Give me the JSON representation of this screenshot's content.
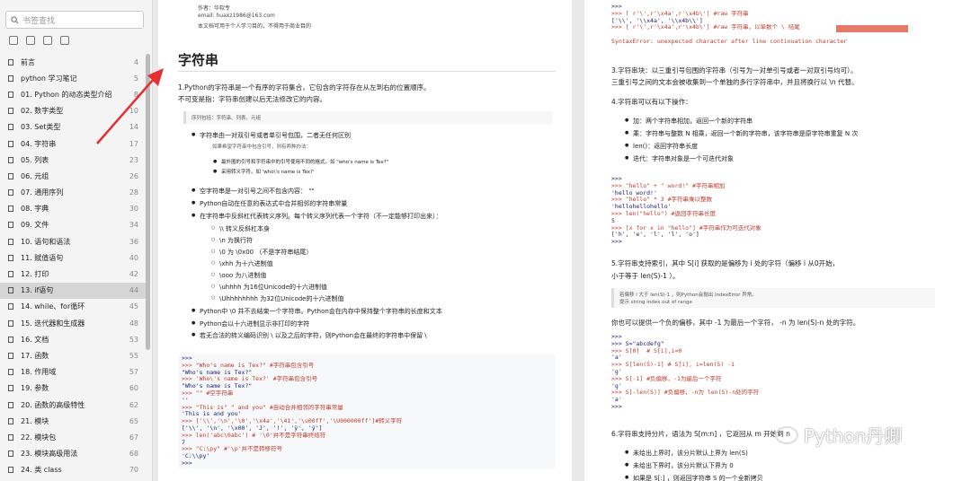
{
  "sidebar": {
    "search_placeholder": "书签查找",
    "items": [
      {
        "label": "前言",
        "page": "4"
      },
      {
        "label": "python 学习笔记",
        "page": "5"
      },
      {
        "label": "01. Python 的动态类型介绍",
        "page": "8"
      },
      {
        "label": "02. 数字类型",
        "page": "10"
      },
      {
        "label": "03. Set类型",
        "page": "14"
      },
      {
        "label": "04. 字符串",
        "page": "17"
      },
      {
        "label": "05. 列表",
        "page": "23"
      },
      {
        "label": "06. 元组",
        "page": "26"
      },
      {
        "label": "07. 通用序列",
        "page": "28"
      },
      {
        "label": "08. 字典",
        "page": "30"
      },
      {
        "label": "09. 文件",
        "page": "34"
      },
      {
        "label": "10. 语句和语法",
        "page": "36"
      },
      {
        "label": "11. 赋值语句",
        "page": "40"
      },
      {
        "label": "12. 打印",
        "page": "42"
      },
      {
        "label": "13. if语句",
        "page": "44"
      },
      {
        "label": "14. while、for循环",
        "page": "45"
      },
      {
        "label": "15. 迭代器和生成器",
        "page": "48"
      },
      {
        "label": "16. 文档",
        "page": "53"
      },
      {
        "label": "17. 函数",
        "page": "55"
      },
      {
        "label": "18. 作用域",
        "page": "57"
      },
      {
        "label": "19. 参数",
        "page": "60"
      },
      {
        "label": "20. 函数的高级特性",
        "page": "62"
      },
      {
        "label": "21. 模块",
        "page": "65"
      },
      {
        "label": "22. 模块包",
        "page": "67"
      },
      {
        "label": "23. 模块高级用法",
        "page": "68"
      },
      {
        "label": "24. 类 class",
        "page": "70"
      }
    ]
  },
  "left": {
    "meta1": "作者：华软专",
    "meta2": "email: huaxz1986@163.com",
    "meta3": "本文档可用于个人学习目的，不得用于商业目的",
    "title": "字符串",
    "intro1": "1.Python的字符串是一个有序的字符集合，它包含的字符存在从左到右的位置顺序。",
    "intro2": "不可变是指：字符串创建以后无法修改它的内容。",
    "quote": "序列包括：字符串、列表、元组",
    "b1": "字符串由一对双引号或者单引号包围，二者无任何区别",
    "s1": "如果希望字符串中包含引号，则有两种办法：",
    "s2": "最外围的引号和字符串中的引号使用不同的格式。如 \"who's name is Tex?\"",
    "s3": "采用转义字符。如 'who\\'s name is Tex?'",
    "b2": "空字符串是一对引号之间不包含内容： \"\"",
    "b3": "Python自动在任意的表达式中合并相邻的字符串常量",
    "b4": "在字符串中反斜杠代表转义序列。每个转义序列代表一个字符（不一定能够打印出来）：",
    "e1": "\\\\ 转义反斜杠本身",
    "e2": "\\n 为换行符",
    "e3": "\\0 为 \\0x00 （不是字符串结尾）",
    "e4": "\\xhh 为十六进制值",
    "e5": "\\ooo 为八进制值",
    "e6": "\\uhhhh 为16位Unicode的十六进制值",
    "e7": "\\Uhhhhhhhh 为32位Unicode的十六进制值",
    "b5": "Python中 \\0 并不去结束一个字符串。Python会在内存中保持整个字符串的长度和文本",
    "b6": "Python会以十六进制显示非打印的字符",
    "b7": "若无合法的转义编码识别 \\ 以及之后的字符，则Python会在最终的字符串中保留 \\",
    "code": [
      ">>>",
      ">>> \"Who's name is Tex?\" #字符串包含引号",
      "\"Who's name is Tex?\"",
      ">>> 'Who\\'s name is Tex?' #字符串包含引号",
      "\"Who's name is Tex?\"",
      ">>> \"\" #空字符串",
      "''",
      ">>> \"This is\" \" and you\" #自动合并相邻的字符串常量",
      "'This is and you'",
      ">>> ['\\\\','\\n','\\0','\\x4a','\\41','\\u00ff','\\U000000ff']#转义字符",
      "['\\\\', '\\n', '\\x00', 'J', '!', 'ÿ', 'ÿ']",
      ">>> len('abc\\0abc') # '\\0'并不是字符串终结符",
      "7",
      ">>> \"C:\\py\" #'\\p'并不是转移符号",
      "'C:\\\\py'",
      ">>>"
    ]
  },
  "right": {
    "code_top": [
      ">>>",
      ">>> [ r'\\',r'\\x4a',r'\\x4b\\'] #raw 字符串",
      "['\\\\', '\\\\x4a', '\\\\x4b\\\\']",
      ">>> [ r'\\',r'\\x4a',r'\\x4b\\'] #raw 字符串，以单数个 \\ 结尾",
      "",
      "SyntaxError: unexpected character after line continuation character"
    ],
    "p3a": "3.字符串块：以三重引号包围的字符串（引号为一对单引号或者一对双引号均可）。",
    "p3b": "三重引号之间的文本会被收集到一个单独的多行字符串中，并且将换行以 \\n 代替。",
    "p4": "4.字符串可以有以下操作：",
    "r1": "加：两个字符串相加，返回一个新的字符串",
    "r2": "乘：字符串与整数 N 相乘，返回一个新的字符串，该字符串是原字符串重复 N 次",
    "r3": "len()：返回字符串长度",
    "r4": "迭代：字符串对象是一个可迭代对象",
    "code_mid": [
      ">>>",
      ">>> \"hello\" + \" word!\" #字符串相加",
      "'hello word!'",
      ">>> \"hello\" * 3 #字符串乘以整数",
      "'hellohellohello'",
      ">>> len(\"hello\") #返回字符串长度",
      "5",
      ">>> [x for x in \"hello\"] #字符串作为可迭代对象",
      "['h', 'e', 'l', 'l', 'o']",
      ">>>"
    ],
    "p5a": "5.字符串支持索引，其中 S[i] 获取的是偏移为 i 处的字符（偏移 i 从0开始，",
    "p5b": "小于等于 len(S)-1 ）。",
    "q1": "若偏移 i 大于 len(S)-1 ，则Python会抛出 IndexError 异常。",
    "q2": "提示 string index out of range",
    "p5c": "你也可以提供一个负的偏移，其中 -1 为最后一个字符， -n 为 len(S)-n 处的字符。",
    "code_low": [
      ">>>",
      ">>> S=\"abcdefg\"",
      ">>> S[0]  # S[i],i=0",
      "'a'",
      ">>> S[len(S)-1] # S[i], i=len(S) -1",
      "'g'",
      ">>> S[-1] #负偏移，-1为最后一个字符",
      "'g'",
      ">>> S[-len(S)] #负偏移，-n为 len(S)-n处的字符",
      "'a'",
      ">>>"
    ],
    "p6": "6.字符串支持分片，语法为 S[m:n] ，它返回从 m 开始到 n",
    "f1": "未给出上界时，该分片默认上界为 len(S)",
    "f2": "未给出下界时，该分片默认下界为 0",
    "f3": "如果是 S[:] ，则返回字符串 S 的一个全新拷贝"
  },
  "watermark": "Python丹卿",
  "colors": {
    "arrow": "#e53030",
    "code_comment": "#c0392b"
  }
}
